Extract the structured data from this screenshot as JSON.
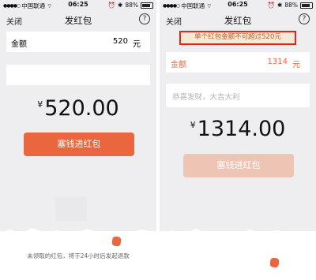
{
  "status": {
    "carrier": "中国联通",
    "time": "06:25",
    "battery": "88%"
  },
  "nav": {
    "close": "关闭",
    "title": "发红包",
    "help": "?"
  },
  "left": {
    "amount_label": "金额",
    "amount_value": "520",
    "unit": "元",
    "big_amount": "520.00",
    "currency": "¥",
    "send_label": "塞钱进红包",
    "footer": "未领取的红包，将于24小时后发起退款"
  },
  "right": {
    "warning": "单个红包金额不可超过520元",
    "amount_label": "金额",
    "amount_value": "1314",
    "unit": "元",
    "note_placeholder": "恭喜发财，大吉大利",
    "big_amount": "1314.00",
    "currency": "¥",
    "send_label": "塞钱进红包"
  },
  "colors": {
    "button_active": "#e9663e",
    "button_disabled": "#eec4b4",
    "warning_text": "#c75a2a",
    "warning_border": "#e3241a",
    "error_text": "#e9663e"
  }
}
